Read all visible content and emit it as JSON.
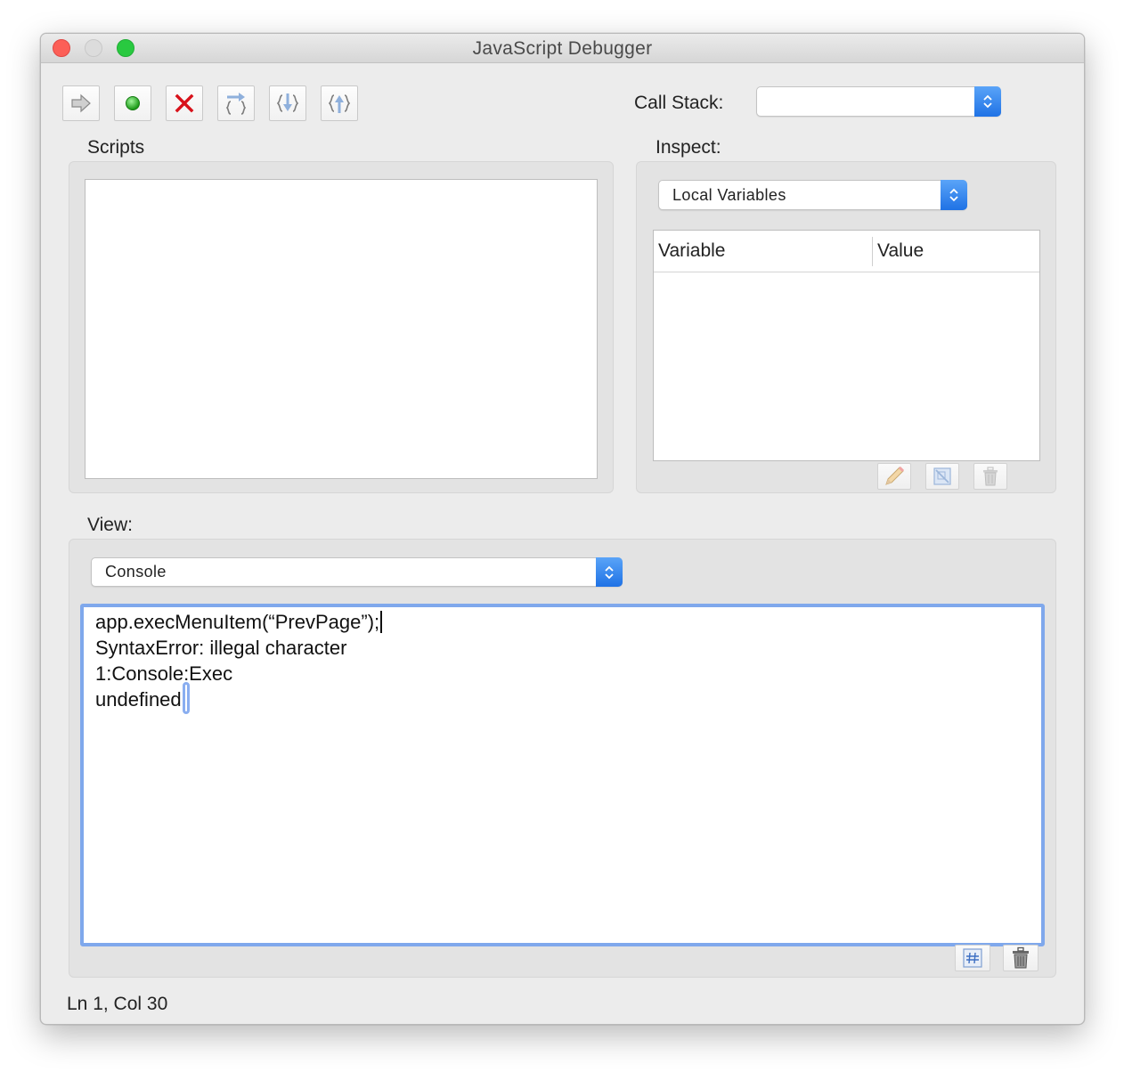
{
  "window": {
    "title": "JavaScript Debugger"
  },
  "toolbar": {
    "buttons": [
      {
        "name": "resume",
        "icon": "right-arrow-icon"
      },
      {
        "name": "interrupt",
        "icon": "green-dot-icon"
      },
      {
        "name": "quit",
        "icon": "red-x-icon"
      },
      {
        "name": "step-over",
        "icon": "step-over-icon"
      },
      {
        "name": "step-into",
        "icon": "step-into-icon"
      },
      {
        "name": "step-out",
        "icon": "step-out-icon"
      }
    ]
  },
  "call_stack": {
    "label": "Call Stack:",
    "value": ""
  },
  "scripts": {
    "label": "Scripts"
  },
  "inspect": {
    "label": "Inspect:",
    "selected": "Local Variables",
    "columns": [
      "Variable",
      "Value"
    ],
    "buttons": [
      "edit-pencil-icon",
      "watch-icon",
      "trash-icon"
    ]
  },
  "view": {
    "label": "View:",
    "selected": "Console",
    "console_lines": [
      "app.execMenuItem(“PrevPage”);",
      "SyntaxError: illegal character",
      "1:Console:Exec",
      "undefined"
    ],
    "buttons": [
      "hash-icon",
      "trash-icon"
    ]
  },
  "status": {
    "text": "Ln 1, Col 30"
  },
  "colors": {
    "accent": "#2a7df0",
    "focus_ring": "#7fa8ec",
    "close": "#fc5f57",
    "maximize": "#29c940"
  }
}
